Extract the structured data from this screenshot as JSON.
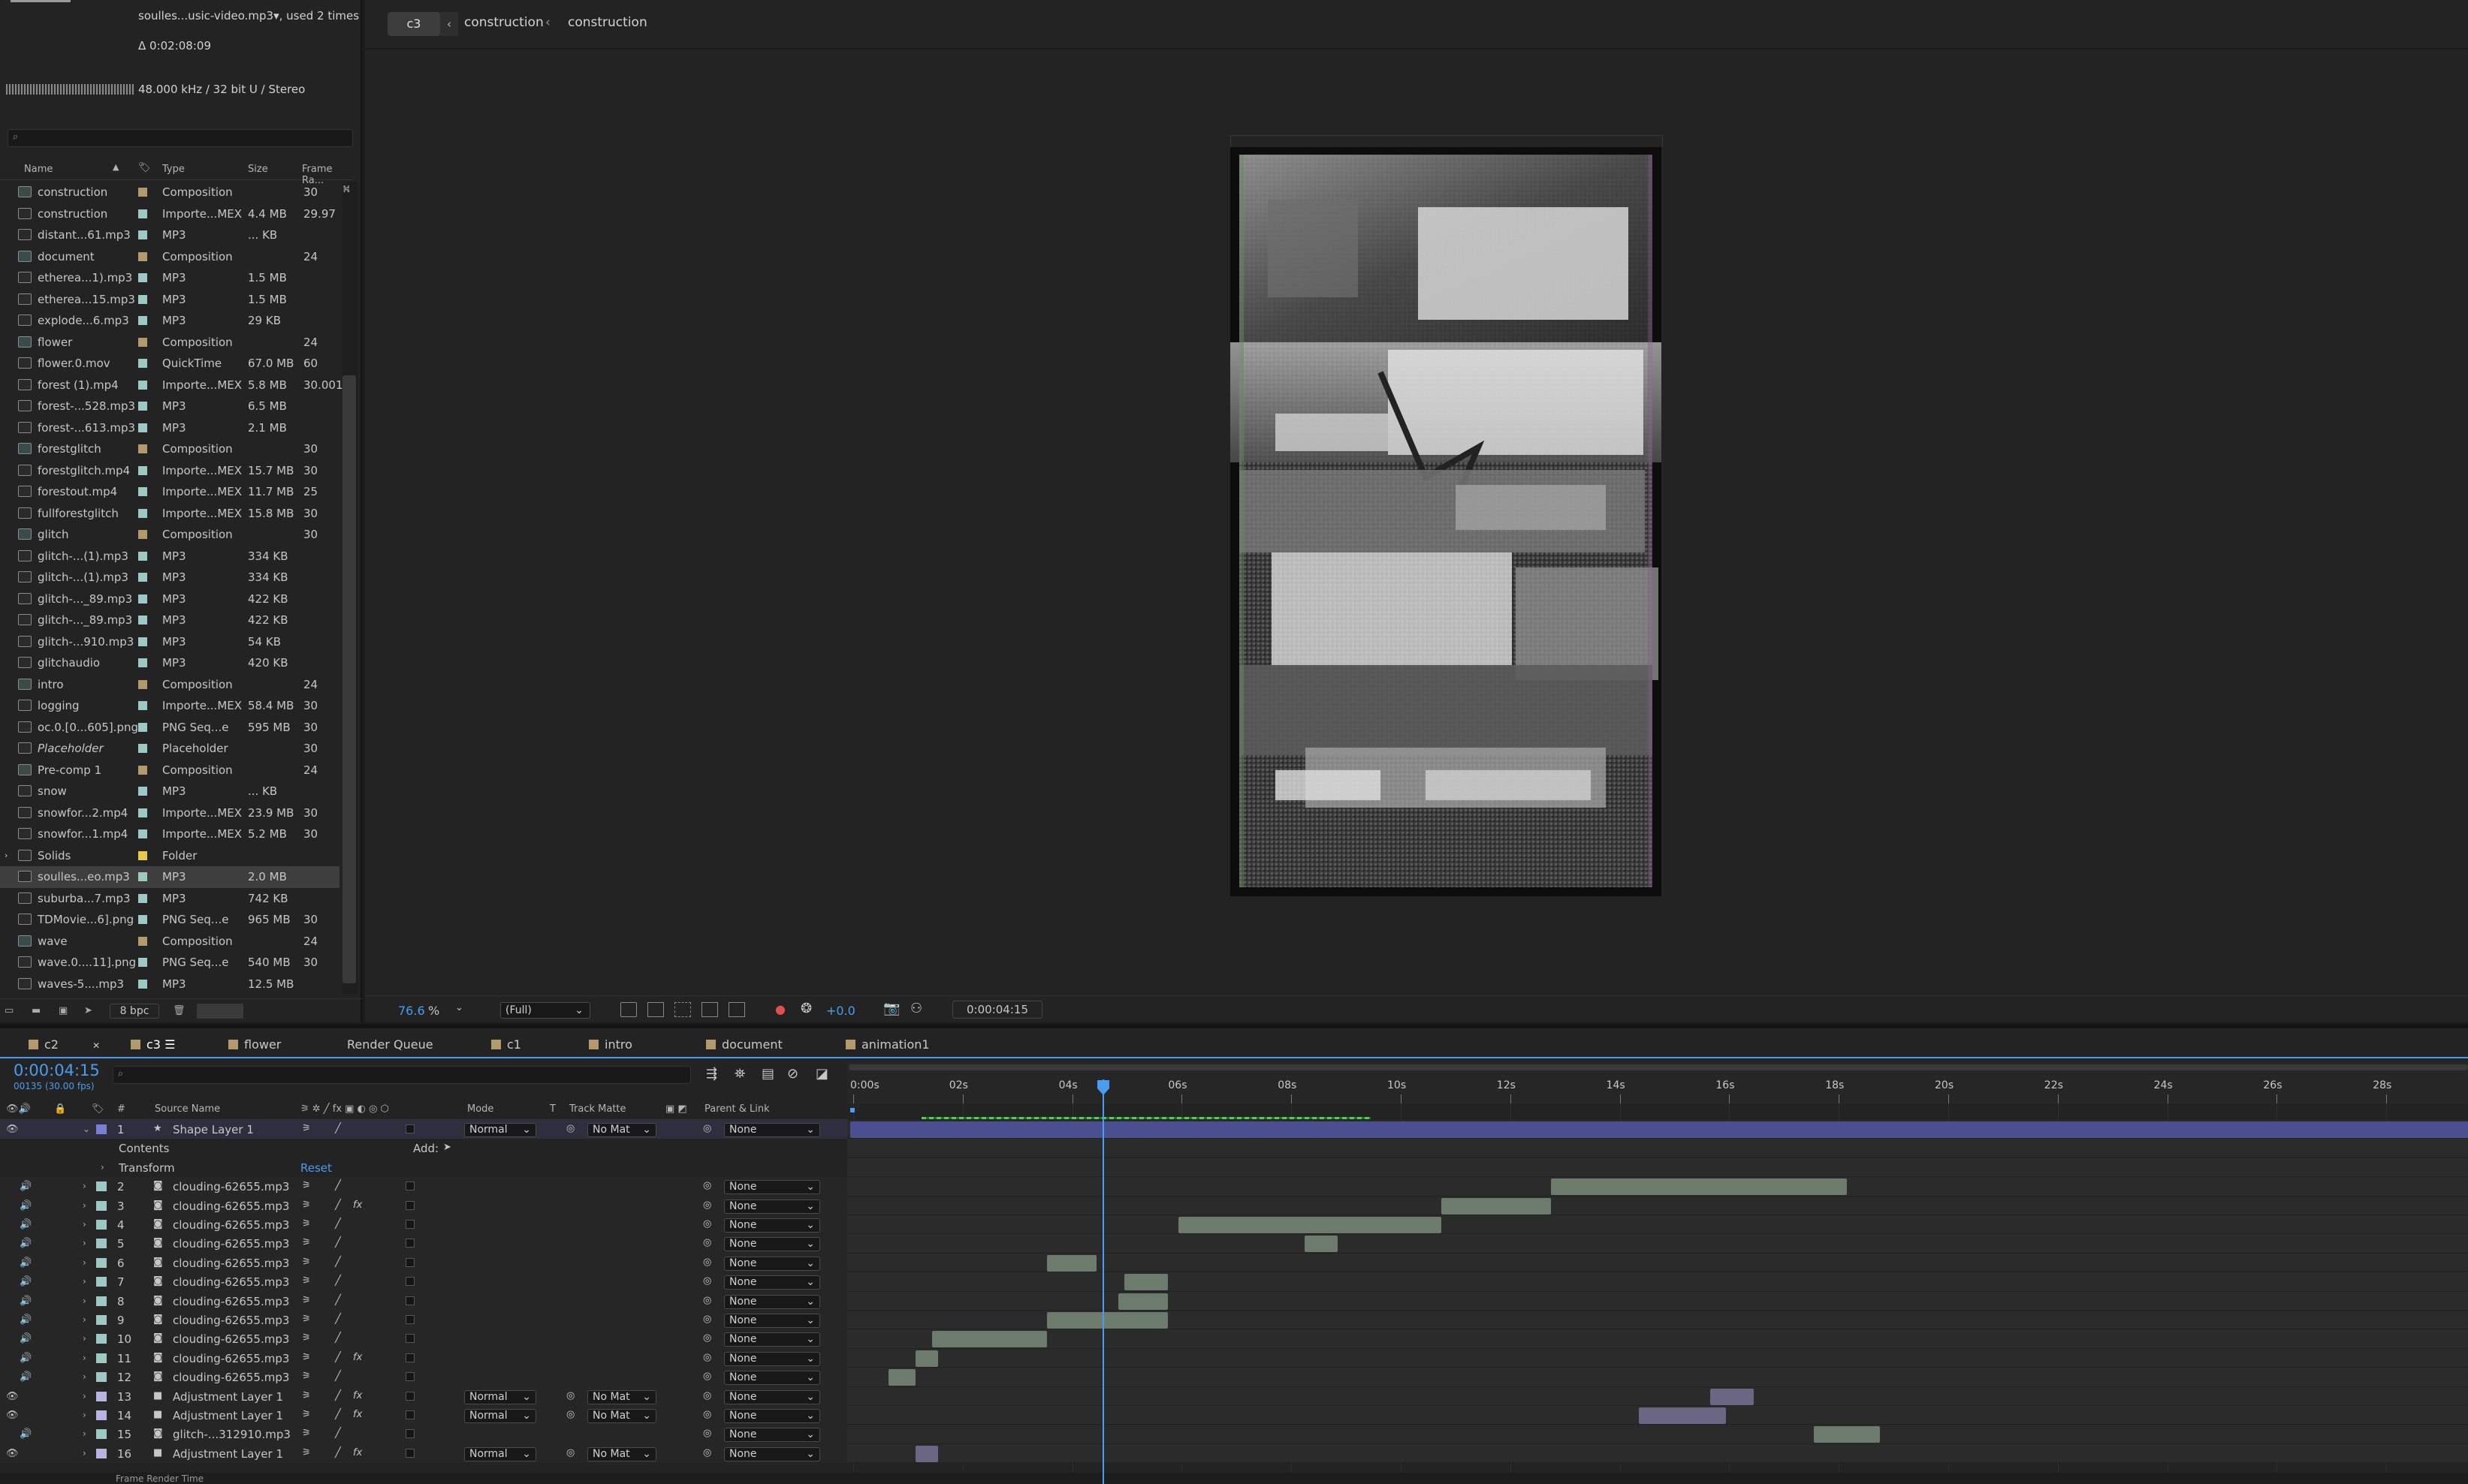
{
  "project": {
    "audio_name": "soulles...usic-video.mp3▾",
    "used": ", used 2 times",
    "duration": "Δ 0:02:08:09",
    "audio_info": "48.000 kHz / 32 bit U / Stereo",
    "columns": {
      "name": "Name",
      "type": "Type",
      "size": "Size",
      "frame_rate": "Frame Ra..."
    },
    "items": [
      {
        "name": "construction",
        "type": "Composition",
        "size": "",
        "fps": "30",
        "color": "#b39a6e",
        "comp": true
      },
      {
        "name": "construction",
        "type": "Importe...MEX",
        "size": "4.4 MB",
        "fps": "29.97",
        "color": "#9dc8c4",
        "comp": false
      },
      {
        "name": "distant...61.mp3",
        "type": "MP3",
        "size": "... KB",
        "fps": "",
        "color": "#9dc8c4",
        "comp": false
      },
      {
        "name": "document",
        "type": "Composition",
        "size": "",
        "fps": "24",
        "color": "#b39a6e",
        "comp": true
      },
      {
        "name": "etherea...1).mp3",
        "type": "MP3",
        "size": "1.5 MB",
        "fps": "",
        "color": "#9dc8c4",
        "comp": false
      },
      {
        "name": "etherea...15.mp3",
        "type": "MP3",
        "size": "1.5 MB",
        "fps": "",
        "color": "#9dc8c4",
        "comp": false
      },
      {
        "name": "explode...6.mp3",
        "type": "MP3",
        "size": "29 KB",
        "fps": "",
        "color": "#9dc8c4",
        "comp": false
      },
      {
        "name": "flower",
        "type": "Composition",
        "size": "",
        "fps": "24",
        "color": "#b39a6e",
        "comp": true
      },
      {
        "name": "flower.0.mov",
        "type": "QuickTime",
        "size": "67.0 MB",
        "fps": "60",
        "color": "#9dc8c4",
        "comp": false
      },
      {
        "name": "forest (1).mp4",
        "type": "Importe...MEX",
        "size": "5.8 MB",
        "fps": "30.001",
        "color": "#9dc8c4",
        "comp": false
      },
      {
        "name": "forest-...528.mp3",
        "type": "MP3",
        "size": "6.5 MB",
        "fps": "",
        "color": "#9dc8c4",
        "comp": false
      },
      {
        "name": "forest-...613.mp3",
        "type": "MP3",
        "size": "2.1 MB",
        "fps": "",
        "color": "#9dc8c4",
        "comp": false
      },
      {
        "name": "forestglitch",
        "type": "Composition",
        "size": "",
        "fps": "30",
        "color": "#b39a6e",
        "comp": true
      },
      {
        "name": "forestglitch.mp4",
        "type": "Importe...MEX",
        "size": "15.7 MB",
        "fps": "30",
        "color": "#9dc8c4",
        "comp": false
      },
      {
        "name": "forestout.mp4",
        "type": "Importe...MEX",
        "size": "11.7 MB",
        "fps": "25",
        "color": "#9dc8c4",
        "comp": false
      },
      {
        "name": "fullforestglitch",
        "type": "Importe...MEX",
        "size": "15.8 MB",
        "fps": "30",
        "color": "#9dc8c4",
        "comp": false
      },
      {
        "name": "glitch",
        "type": "Composition",
        "size": "",
        "fps": "30",
        "color": "#b39a6e",
        "comp": true
      },
      {
        "name": "glitch-...(1).mp3",
        "type": "MP3",
        "size": "334 KB",
        "fps": "",
        "color": "#9dc8c4",
        "comp": false
      },
      {
        "name": "glitch-...(1).mp3",
        "type": "MP3",
        "size": "334 KB",
        "fps": "",
        "color": "#9dc8c4",
        "comp": false
      },
      {
        "name": "glitch-..._89.mp3",
        "type": "MP3",
        "size": "422 KB",
        "fps": "",
        "color": "#9dc8c4",
        "comp": false
      },
      {
        "name": "glitch-..._89.mp3",
        "type": "MP3",
        "size": "422 KB",
        "fps": "",
        "color": "#9dc8c4",
        "comp": false
      },
      {
        "name": "glitch-...910.mp3",
        "type": "MP3",
        "size": "54 KB",
        "fps": "",
        "color": "#9dc8c4",
        "comp": false
      },
      {
        "name": "glitchaudio",
        "type": "MP3",
        "size": "420 KB",
        "fps": "",
        "color": "#9dc8c4",
        "comp": false
      },
      {
        "name": "intro",
        "type": "Composition",
        "size": "",
        "fps": "24",
        "color": "#b39a6e",
        "comp": true
      },
      {
        "name": "logging",
        "type": "Importe...MEX",
        "size": "58.4 MB",
        "fps": "30",
        "color": "#9dc8c4",
        "comp": false
      },
      {
        "name": "oc.0.[0...605].png",
        "type": "PNG Seq...e",
        "size": "595 MB",
        "fps": "30",
        "color": "#9dc8c4",
        "comp": false
      },
      {
        "name": "Placeholder",
        "type": "Placeholder",
        "size": "",
        "fps": "30",
        "color": "#9dc8c4",
        "comp": false
      },
      {
        "name": "Pre-comp 1",
        "type": "Composition",
        "size": "",
        "fps": "24",
        "color": "#b39a6e",
        "comp": true
      },
      {
        "name": "snow",
        "type": "MP3",
        "size": "... KB",
        "fps": "",
        "color": "#9dc8c4",
        "comp": false
      },
      {
        "name": "snowfor...2.mp4",
        "type": "Importe...MEX",
        "size": "23.9 MB",
        "fps": "30",
        "color": "#9dc8c4",
        "comp": false
      },
      {
        "name": "snowfor...1.mp4",
        "type": "Importe...MEX",
        "size": "5.2 MB",
        "fps": "30",
        "color": "#9dc8c4",
        "comp": false
      },
      {
        "name": "Solids",
        "type": "Folder",
        "size": "",
        "fps": "",
        "color": "#e6c84a",
        "comp": false
      },
      {
        "name": "soulles...eo.mp3",
        "type": "MP3",
        "size": "2.0 MB",
        "fps": "",
        "color": "#9dc8c4",
        "comp": false,
        "selected": true
      },
      {
        "name": "suburba...7.mp3",
        "type": "MP3",
        "size": "742 KB",
        "fps": "",
        "color": "#9dc8c4",
        "comp": false
      },
      {
        "name": "TDMovie...6].png",
        "type": "PNG Seq...e",
        "size": "965 MB",
        "fps": "30",
        "color": "#9dc8c4",
        "comp": false
      },
      {
        "name": "wave",
        "type": "Composition",
        "size": "",
        "fps": "24",
        "color": "#b39a6e",
        "comp": true
      },
      {
        "name": "wave.0....11].png",
        "type": "PNG Seq...e",
        "size": "540 MB",
        "fps": "30",
        "color": "#9dc8c4",
        "comp": false
      },
      {
        "name": "waves-5....mp3",
        "type": "MP3",
        "size": "12.5 MB",
        "fps": "",
        "color": "#9dc8c4",
        "comp": false
      }
    ],
    "bpc": "8 bpc"
  },
  "viewer": {
    "tab": "c3",
    "crumb1": "construction",
    "crumb2": "construction",
    "zoom": "76.6",
    "zoom_unit": "%",
    "resolution": "(Full)",
    "exposure": "+0.0",
    "timecode": "0:00:04:15"
  },
  "tabs": [
    {
      "label": "c2",
      "color": "#b39a6e"
    },
    {
      "label": "c3",
      "color": "#b39a6e"
    },
    {
      "label": "flower",
      "color": "#b39a6e"
    },
    {
      "label": "Render Queue",
      "color": ""
    },
    {
      "label": "c1",
      "color": "#b39a6e"
    },
    {
      "label": "intro",
      "color": "#b39a6e"
    },
    {
      "label": "document",
      "color": "#b39a6e"
    },
    {
      "label": "animation1",
      "color": "#b39a6e"
    }
  ],
  "timeline": {
    "current_time": "0:00:04:15",
    "frame_info": "00135 (30.00 fps)",
    "headers": {
      "num": "#",
      "source": "Source Name",
      "mode": "Mode",
      "t": "T",
      "track_matte": "Track Matte",
      "parent": "Parent & Link"
    },
    "ruler": [
      "0:00s",
      "02s",
      "04s",
      "06s",
      "08s",
      "10s",
      "12s",
      "14s",
      "16s",
      "18s",
      "20s",
      "22s",
      "24s",
      "26s",
      "28s"
    ],
    "contents_label": "Contents",
    "add_label": "Add:",
    "transform_label": "Transform",
    "reset_label": "Reset",
    "footer": "Frame Render Time",
    "layers": [
      {
        "num": "1",
        "name": "Shape Layer 1",
        "type": "shape",
        "mode": "Normal",
        "matte": "No Mat",
        "parent": "None",
        "color": "#7a7fd1",
        "bar": [
          0,
          30
        ],
        "barcolor": "#4a4f8f"
      },
      {
        "num": "2",
        "name": "clouding-62655.mp3",
        "type": "audio",
        "parent": "None",
        "color": "#9dc8c4",
        "bar": [
          12.8,
          18.2
        ],
        "barcolor": "#6d7b6c"
      },
      {
        "num": "3",
        "name": "clouding-62655.mp3",
        "type": "audio",
        "fx": true,
        "parent": "None",
        "color": "#9dc8c4",
        "bar": [
          10.8,
          12.8
        ],
        "barcolor": "#6d7b6c"
      },
      {
        "num": "4",
        "name": "clouding-62655.mp3",
        "type": "audio",
        "parent": "None",
        "color": "#9dc8c4",
        "bar": [
          6.0,
          10.8
        ],
        "barcolor": "#6d7b6c"
      },
      {
        "num": "5",
        "name": "clouding-62655.mp3",
        "type": "audio",
        "parent": "None",
        "color": "#9dc8c4",
        "bar": [
          8.3,
          8.9
        ],
        "barcolor": "#6d7b6c"
      },
      {
        "num": "6",
        "name": "clouding-62655.mp3",
        "type": "audio",
        "parent": "None",
        "color": "#9dc8c4",
        "bar": [
          3.6,
          4.5
        ],
        "barcolor": "#6d7b6c"
      },
      {
        "num": "7",
        "name": "clouding-62655.mp3",
        "type": "audio",
        "parent": "None",
        "color": "#9dc8c4",
        "bar": [
          5.0,
          5.8
        ],
        "barcolor": "#6d7b6c"
      },
      {
        "num": "8",
        "name": "clouding-62655.mp3",
        "type": "audio",
        "parent": "None",
        "color": "#9dc8c4",
        "bar": [
          4.9,
          5.8
        ],
        "barcolor": "#6d7b6c"
      },
      {
        "num": "9",
        "name": "clouding-62655.mp3",
        "type": "audio",
        "parent": "None",
        "color": "#9dc8c4",
        "bar": [
          3.6,
          5.8
        ],
        "barcolor": "#6d7b6c"
      },
      {
        "num": "10",
        "name": "clouding-62655.mp3",
        "type": "audio",
        "parent": "None",
        "color": "#9dc8c4",
        "bar": [
          1.5,
          3.6
        ],
        "barcolor": "#6d7b6c"
      },
      {
        "num": "11",
        "name": "clouding-62655.mp3",
        "type": "audio",
        "fx": true,
        "parent": "None",
        "color": "#9dc8c4",
        "bar": [
          1.2,
          1.6
        ],
        "barcolor": "#6d7b6c"
      },
      {
        "num": "12",
        "name": "clouding-62655.mp3",
        "type": "audio",
        "parent": "None",
        "color": "#9dc8c4",
        "bar": [
          0.7,
          1.2
        ],
        "barcolor": "#6d7b6c"
      },
      {
        "num": "13",
        "name": "Adjustment Layer 1",
        "type": "adj",
        "fx": true,
        "mode": "Normal",
        "matte": "No Mat",
        "parent": "None",
        "color": "#b9b3e0",
        "bar": [
          15.7,
          16.5
        ],
        "barcolor": "#6a6684"
      },
      {
        "num": "14",
        "name": "Adjustment Layer 1",
        "type": "adj",
        "fx": true,
        "mode": "Normal",
        "matte": "No Mat",
        "parent": "None",
        "color": "#b9b3e0",
        "bar": [
          14.4,
          16.0
        ],
        "barcolor": "#6a6684"
      },
      {
        "num": "15",
        "name": "glitch-...312910.mp3",
        "type": "audio",
        "parent": "None",
        "color": "#9dc8c4",
        "bar": [
          17.6,
          18.8
        ],
        "barcolor": "#6d7b6c"
      },
      {
        "num": "16",
        "name": "Adjustment Layer 1",
        "type": "adj",
        "fx": true,
        "mode": "Normal",
        "matte": "No Mat",
        "parent": "None",
        "color": "#b9b3e0",
        "bar": [
          1.2,
          1.6
        ],
        "barcolor": "#6a6684"
      }
    ]
  }
}
